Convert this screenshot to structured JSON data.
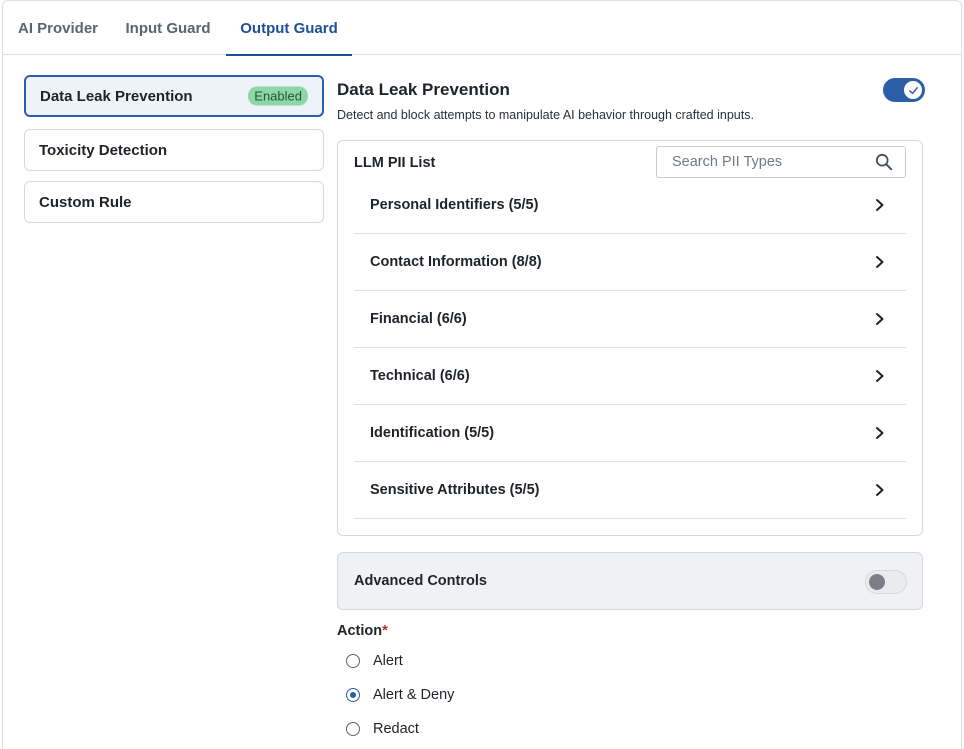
{
  "tabs": [
    {
      "label": "AI Provider",
      "active": false
    },
    {
      "label": "Input Guard",
      "active": false
    },
    {
      "label": "Output Guard",
      "active": true
    }
  ],
  "rules": [
    {
      "label": "Data Leak Prevention",
      "badge": "Enabled",
      "active": true
    },
    {
      "label": "Toxicity Detection",
      "active": false
    },
    {
      "label": "Custom Rule",
      "active": false
    }
  ],
  "section": {
    "title": "Data Leak Prevention",
    "description": "Detect and block attempts to manipulate AI behavior through crafted inputs.",
    "enabled": true
  },
  "pii": {
    "title": "LLM PII List",
    "search_placeholder": "Search PII Types",
    "search_value": "",
    "categories": [
      {
        "label": "Personal Identifiers (5/5)"
      },
      {
        "label": "Contact Information (8/8)"
      },
      {
        "label": "Financial (6/6)"
      },
      {
        "label": "Technical (6/6)"
      },
      {
        "label": "Identification (5/5)"
      },
      {
        "label": "Sensitive Attributes (5/5)"
      }
    ]
  },
  "advanced": {
    "label": "Advanced Controls",
    "enabled": false
  },
  "action": {
    "label": "Action",
    "required_mark": "*",
    "options": [
      {
        "label": "Alert",
        "selected": false
      },
      {
        "label": "Alert & Deny",
        "selected": true
      },
      {
        "label": "Redact",
        "selected": false
      }
    ]
  },
  "colors": {
    "accent": "#2d5fa8",
    "active_tab": "#1f4f96",
    "badge_bg": "#8fd6a6",
    "required": "#c0282d"
  }
}
